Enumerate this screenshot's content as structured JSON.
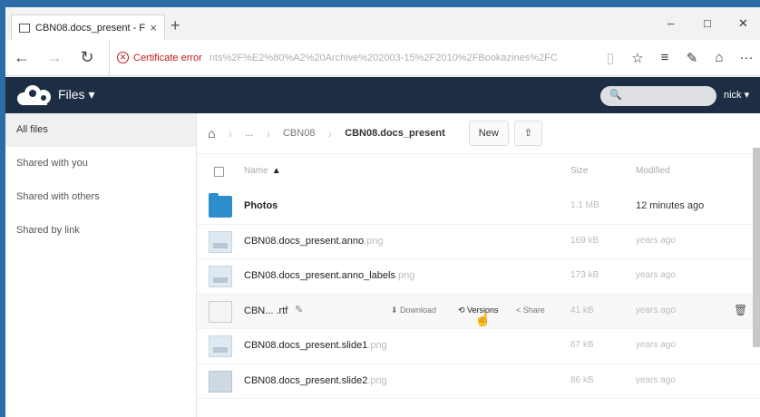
{
  "browser": {
    "tab_title": "CBN08.docs_present - F",
    "tab_close": "×",
    "new_tab": "+",
    "window_controls": {
      "minimize": "–",
      "maximize": "□",
      "close": "✕"
    },
    "nav": {
      "back": "←",
      "forward": "→",
      "refresh": "↻"
    },
    "cert_error": "Certificate error",
    "url": "nts%2F%E2%80%A2%20Archive%202003-15%2F2010%2FBookazines%2FC",
    "tools": {
      "reading_view": "▯",
      "favorite": "☆",
      "hub": "≡",
      "notes": "✎",
      "share": "⌂",
      "more": "···"
    }
  },
  "oc_header": {
    "apps_menu": "Files ▾",
    "search_icon": "🔍",
    "user": "nick ▾"
  },
  "sidebar": {
    "items": [
      {
        "label": "All files"
      },
      {
        "label": "Shared with you"
      },
      {
        "label": "Shared with others"
      },
      {
        "label": "Shared by link"
      }
    ]
  },
  "breadcrumb": {
    "home": "⌂",
    "ellipsis": "...",
    "parent": "CBN08",
    "current": "CBN08.docs_present",
    "sep": "›"
  },
  "buttons": {
    "new": "New",
    "upload": "⇧"
  },
  "columns": {
    "name": "Name",
    "sort_arrow": "▲",
    "size": "Size",
    "modified": "Modified"
  },
  "files": [
    {
      "name": "Photos",
      "ext": "",
      "size": "1.1 MB",
      "modified": "12 minutes ago"
    },
    {
      "name": "CBN08.docs_present.anno",
      "ext": ".png",
      "size": "169 kB",
      "modified": "years ago"
    },
    {
      "name": "CBN08.docs_present.anno_labels",
      "ext": ".png",
      "size": "173 kB",
      "modified": "years ago"
    },
    {
      "name": "CBN... .rtf",
      "ext": "",
      "size": "41 kB",
      "modified": "years ago"
    },
    {
      "name": "CBN08.docs_present.slide1",
      "ext": ".png",
      "size": "67 kB",
      "modified": "years ago"
    },
    {
      "name": "CBN08.docs_present.slide2",
      "ext": ".png",
      "size": "86 kB",
      "modified": "years ago"
    }
  ],
  "row_actions": {
    "download": "⬇ Download",
    "versions": "⟲ Versions",
    "share": "< Share",
    "rename_icon": "✎",
    "delete_icon": "🗑",
    "cursor": "☝"
  }
}
